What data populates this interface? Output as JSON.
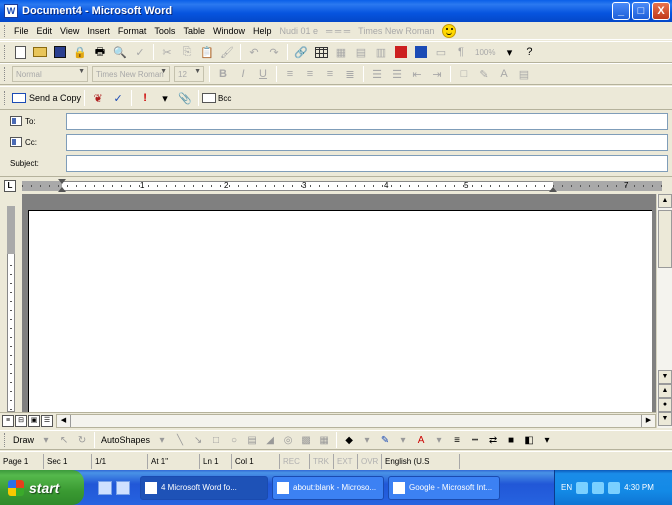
{
  "window": {
    "title": "Document4 - Microsoft Word",
    "app_icon": "W",
    "buttons": {
      "minimize": "_",
      "maximize": "□",
      "close": "X"
    }
  },
  "menubar": {
    "items": [
      {
        "label": "File"
      },
      {
        "label": "Edit"
      },
      {
        "label": "View"
      },
      {
        "label": "Insert"
      },
      {
        "label": "Format"
      },
      {
        "label": "Tools"
      },
      {
        "label": "Table"
      },
      {
        "label": "Window"
      },
      {
        "label": "Help"
      }
    ],
    "style_box": "Nudi 01 e",
    "font_box": "Times New Roman"
  },
  "standard_toolbar": {
    "zoom": "100%",
    "help_label": "?"
  },
  "formatting_toolbar": {
    "style": "Normal",
    "font": "Times New Roman",
    "size": "12",
    "bold": "B",
    "italic": "I",
    "underline": "U"
  },
  "email_toolbar": {
    "send_label": "Send a Copy",
    "bcc_label": "Bcc"
  },
  "address": {
    "to_label": "To:",
    "cc_label": "Cc:",
    "subject_label": "Subject:",
    "to_value": "",
    "cc_value": "",
    "subject_value": ""
  },
  "ruler": {
    "tab_selector": "L",
    "numbers": [
      "1",
      "2",
      "3",
      "4",
      "5",
      "7"
    ]
  },
  "drawing_toolbar": {
    "draw_label": "Draw",
    "autoshapes_label": "AutoShapes"
  },
  "statusbar": {
    "page": "Page 1",
    "section": "Sec 1",
    "pages": "1/1",
    "at": "At 1\"",
    "line": "Ln 1",
    "col": "Col 1",
    "rec": "REC",
    "trk": "TRK",
    "ext": "EXT",
    "ovr": "OVR",
    "language": "English (U.S"
  },
  "taskbar": {
    "start_label": "start",
    "tasks": [
      {
        "label": "4 Microsoft Word fo...",
        "active": true
      },
      {
        "label": "about:blank - Microso...",
        "active": false
      },
      {
        "label": "Google - Microsoft Int...",
        "active": false
      }
    ],
    "tray_lang": "EN",
    "clock": "4:30 PM"
  },
  "colors": {
    "titlebar": "#0A5FE8",
    "chrome": "#ECE9D8",
    "taskbar": "#2663E0",
    "start": "#3A9A32"
  }
}
